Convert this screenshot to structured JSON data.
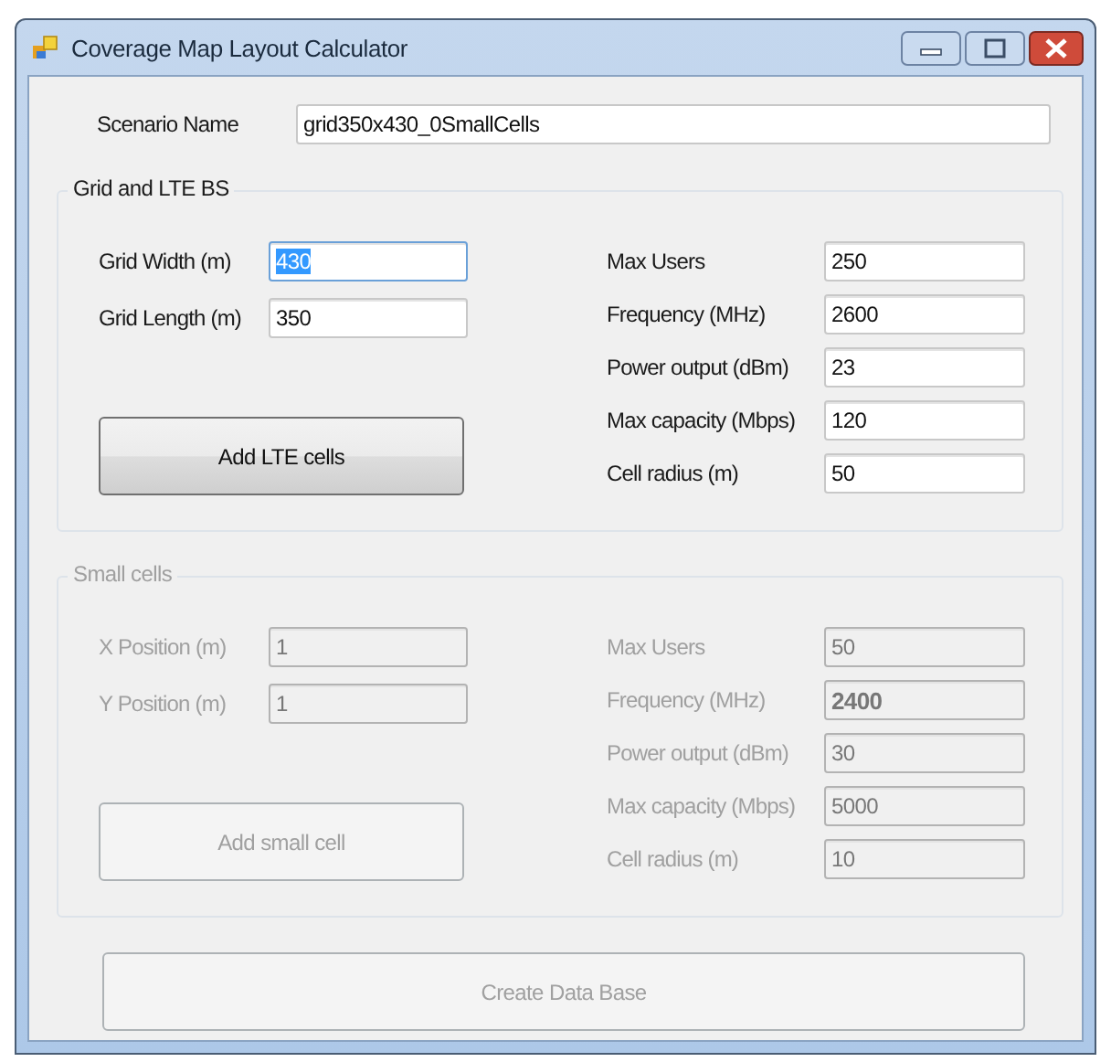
{
  "window": {
    "title": "Coverage Map Layout Calculator"
  },
  "scenario": {
    "label": "Scenario Name",
    "value": "grid350x430_0SmallCells"
  },
  "groups": [
    {
      "title": "Grid and LTE BS",
      "disabled": false,
      "left_fields": [
        {
          "label": "Grid Width (m)",
          "value": "430",
          "focused": true,
          "bold": false
        },
        {
          "label": "Grid Length (m)",
          "value": "350",
          "focused": false,
          "bold": false
        }
      ],
      "button": "Add LTE cells",
      "right_fields": [
        {
          "label": "Max Users",
          "value": "250",
          "focused": false,
          "bold": false
        },
        {
          "label": "Frequency (MHz)",
          "value": "2600",
          "focused": false,
          "bold": false
        },
        {
          "label": "Power output (dBm)",
          "value": "23",
          "focused": false,
          "bold": false
        },
        {
          "label": "Max capacity (Mbps)",
          "value": "120",
          "focused": false,
          "bold": false
        },
        {
          "label": "Cell radius (m)",
          "value": "50",
          "focused": false,
          "bold": false
        }
      ]
    },
    {
      "title": "Small cells",
      "disabled": true,
      "left_fields": [
        {
          "label": "X Position (m)",
          "value": "1",
          "focused": false,
          "bold": false
        },
        {
          "label": "Y Position (m)",
          "value": "1",
          "focused": false,
          "bold": false
        }
      ],
      "button": "Add small cell",
      "right_fields": [
        {
          "label": "Max Users",
          "value": "50",
          "focused": false,
          "bold": false
        },
        {
          "label": "Frequency (MHz)",
          "value": "2400",
          "focused": false,
          "bold": true
        },
        {
          "label": "Power output (dBm)",
          "value": "30",
          "focused": false,
          "bold": false
        },
        {
          "label": "Max capacity (Mbps)",
          "value": "5000",
          "focused": false,
          "bold": false
        },
        {
          "label": "Cell radius (m)",
          "value": "10",
          "focused": false,
          "bold": false
        }
      ]
    }
  ],
  "create_button": {
    "label": "Create Data Base",
    "disabled": true
  }
}
